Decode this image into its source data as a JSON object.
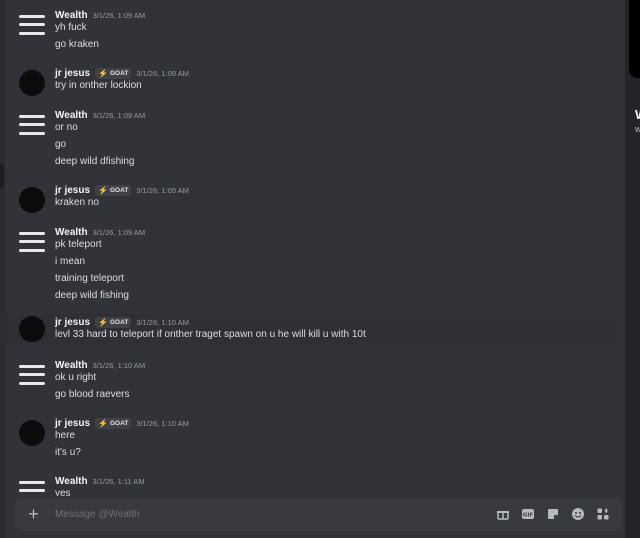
{
  "messages": [
    {
      "author": "Wealth",
      "time": "3/1/26, 1:09 AM",
      "avatar": "menu-avatar",
      "lines": [
        "yh fuck",
        "go kraken"
      ]
    },
    {
      "author": "jr jesus",
      "badge": "GOAT",
      "time": "3/1/26, 1:09 AM",
      "avatar": "dark-avatar",
      "lines": [
        "try in onther lockion"
      ]
    },
    {
      "author": "Wealth",
      "time": "3/1/26, 1:09 AM",
      "avatar": "menu-avatar",
      "lines": [
        "or no",
        "go",
        "deep wild dfishing"
      ]
    },
    {
      "author": "jr jesus",
      "badge": "GOAT",
      "time": "3/1/26, 1:09 AM",
      "avatar": "dark-avatar",
      "lines": [
        "kraken no"
      ]
    },
    {
      "author": "Wealth",
      "time": "3/1/26, 1:09 AM",
      "avatar": "menu-avatar",
      "lines": [
        "pk teleport",
        "i mean",
        "training teleport",
        "deep wild fishing"
      ]
    },
    {
      "author": "jr jesus",
      "badge": "GOAT",
      "time": "3/1/26, 1:10 AM",
      "avatar": "dark-avatar",
      "lines": [
        "levl 33 hard to teleport if onther traget spawn on u he will kill u with 10t"
      ]
    },
    {
      "author": "Wealth",
      "time": "3/1/26, 1:10 AM",
      "avatar": "menu-avatar",
      "lines": [
        "ok u right",
        "go blood raevers"
      ]
    },
    {
      "author": "jr jesus",
      "badge": "GOAT",
      "time": "3/1/26, 1:10 AM",
      "avatar": "dark-avatar",
      "lines": [
        "here",
        "it's u?"
      ]
    },
    {
      "author": "Wealth",
      "time": "3/1/26, 1:11 AM",
      "avatar": "menu-avatar",
      "lines": [
        "yes"
      ]
    }
  ],
  "composer": {
    "placeholder": "Message @Wealth"
  },
  "composer_tools": [
    "gift-icon",
    "gif-icon",
    "sticker-icon",
    "emoji-icon",
    "apps-icon"
  ],
  "colors": {
    "background": "#313338",
    "composer": "#383a40",
    "text": "#dbdee1",
    "muted": "#949ba4",
    "badge_bolt": "#f0b232"
  }
}
